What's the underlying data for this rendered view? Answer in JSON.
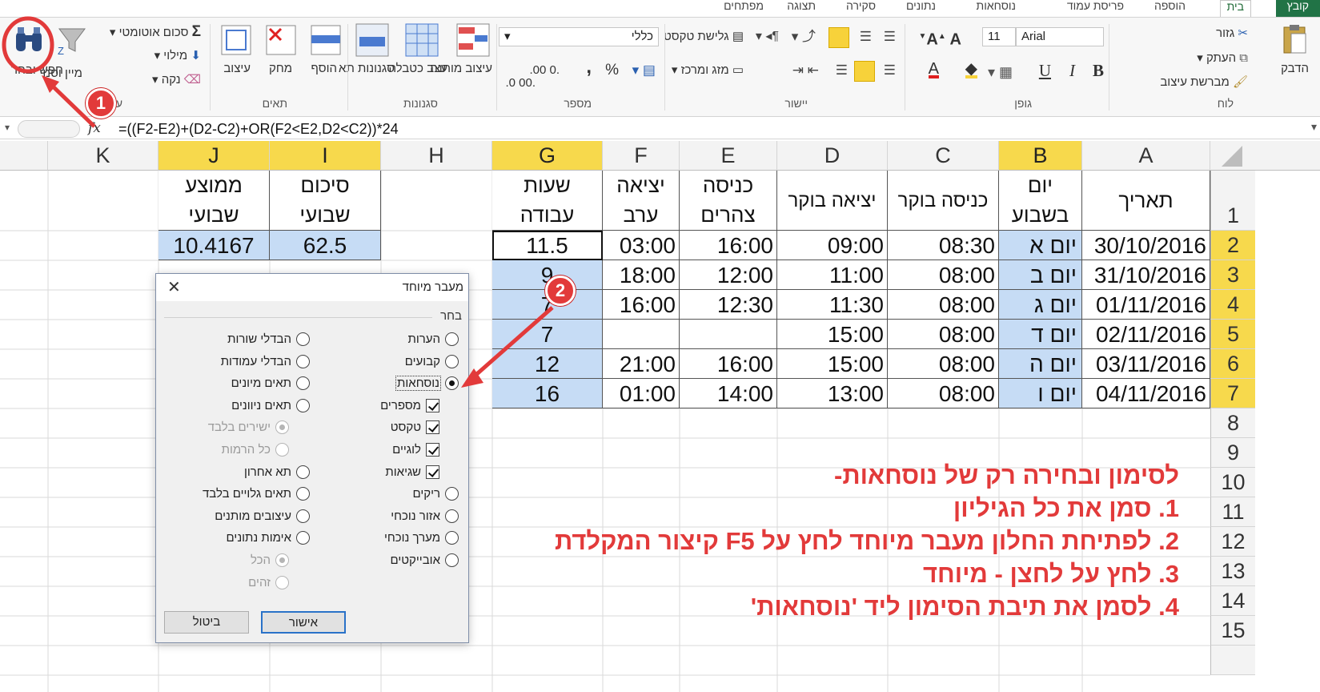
{
  "tabs": [
    "קובץ",
    "בית",
    "הוספה",
    "פריסת עמוד",
    "נוסחאות",
    "נתונים",
    "סקירה",
    "תצוגה",
    "מפתחים"
  ],
  "ribbon": {
    "clipboard": {
      "paste": "הדבק",
      "cut": "גזור",
      "copy": "העתק",
      "format_painter": "מברשת עיצוב",
      "group": "לוח"
    },
    "font": {
      "name": "Arial",
      "size": "11",
      "bold": "B",
      "italic": "I",
      "underline": "U",
      "group": "גופן"
    },
    "alignment": {
      "wrap": "גלישת טקסט",
      "merge": "מזג ומרכז",
      "group": "יישור"
    },
    "number": {
      "format": "כללי",
      "percent": "%",
      "comma": ",",
      "inc_dec": ".00 0.",
      "dec_dec": ".0 00.",
      "group": "מספר"
    },
    "styles": {
      "conditional": "עיצוב מותנה",
      "table": "עצב כטבלה",
      "cell": "סגנונות תא",
      "group": "סגנונות"
    },
    "cells": {
      "insert": "הוסף",
      "delete": "מחק",
      "format": "עיצוב",
      "group": "תאים"
    },
    "editing": {
      "autosum": "סכום אוטומטי",
      "fill": "מילוי",
      "clear": "נקה",
      "sort": "מיין וסנן",
      "find": "חפש ובחר",
      "group": "עריכה"
    }
  },
  "formula_bar": {
    "fx": "fx",
    "formula": "=((F2-E2)+(D2-C2)+OR(F2<E2,D2<C2))*24"
  },
  "columns": [
    "A",
    "B",
    "C",
    "D",
    "E",
    "F",
    "G",
    "H",
    "I",
    "J",
    "K"
  ],
  "rows": [
    "1",
    "2",
    "3",
    "4",
    "5",
    "6",
    "7",
    "8",
    "9",
    "10",
    "11",
    "12",
    "13",
    "14",
    "15"
  ],
  "headers": {
    "A": "תאריך",
    "B1": "יום",
    "B2": "בשבוע",
    "C": "כניסה בוקר",
    "D": "יציאה בוקר",
    "E1": "כניסה",
    "E2": "צהרים",
    "F1": "יציאה",
    "F2": "ערב",
    "G1": "שעות",
    "G2": "עבודה",
    "I1": "סיכום",
    "I2": "שבועי",
    "J1": "ממוצע",
    "J2": "שבועי"
  },
  "table": [
    {
      "date": "30/10/2016",
      "day": "יום א",
      "in_am": "08:30",
      "out_am": "09:00",
      "in_noon": "16:00",
      "out_eve": "03:00",
      "hours": "11.5"
    },
    {
      "date": "31/10/2016",
      "day": "יום ב",
      "in_am": "08:00",
      "out_am": "11:00",
      "in_noon": "12:00",
      "out_eve": "18:00",
      "hours": "9"
    },
    {
      "date": "01/11/2016",
      "day": "יום ג",
      "in_am": "08:00",
      "out_am": "11:30",
      "in_noon": "12:30",
      "out_eve": "16:00",
      "hours": "7"
    },
    {
      "date": "02/11/2016",
      "day": "יום ד",
      "in_am": "08:00",
      "out_am": "15:00",
      "in_noon": "",
      "out_eve": "",
      "hours": "7"
    },
    {
      "date": "03/11/2016",
      "day": "יום ה",
      "in_am": "08:00",
      "out_am": "15:00",
      "in_noon": "16:00",
      "out_eve": "21:00",
      "hours": "12"
    },
    {
      "date": "04/11/2016",
      "day": "יום ו",
      "in_am": "08:00",
      "out_am": "13:00",
      "in_noon": "14:00",
      "out_eve": "01:00",
      "hours": "16"
    }
  ],
  "summary": {
    "weekly_total": "62.5",
    "weekly_avg": "10.4167"
  },
  "instructions": [
    "לסימון ובחירה רק של נוסחאות-",
    "1. סמן את כל הגיליון",
    "2. לפתיחת החלון מעבר מיוחד לחץ על  F5  קיצור המקלדת",
    "3. לחץ על לחצן - מיוחד",
    "4. לסמן את תיבת הסימון ליד 'נוסחאות'"
  ],
  "dialog": {
    "title": "מעבר מיוחד",
    "group": "בחר",
    "right_options": [
      {
        "label": "הערות",
        "kind": "radio",
        "on": false,
        "dis": false
      },
      {
        "label": "קבועים",
        "kind": "radio",
        "on": false,
        "dis": false
      },
      {
        "label": "נוסחאות",
        "kind": "radio",
        "on": true,
        "dis": false
      },
      {
        "label": "מספרים",
        "kind": "check",
        "on": true,
        "dis": false
      },
      {
        "label": "טקסט",
        "kind": "check",
        "on": true,
        "dis": false
      },
      {
        "label": "לוגיים",
        "kind": "check",
        "on": true,
        "dis": false
      },
      {
        "label": "שגיאות",
        "kind": "check",
        "on": true,
        "dis": false
      },
      {
        "label": "ריקים",
        "kind": "radio",
        "on": false,
        "dis": false
      },
      {
        "label": "אזור נוכחי",
        "kind": "radio",
        "on": false,
        "dis": false
      },
      {
        "label": "מערך נוכחי",
        "kind": "radio",
        "on": false,
        "dis": false
      },
      {
        "label": "אובייקטים",
        "kind": "radio",
        "on": false,
        "dis": false
      }
    ],
    "left_options": [
      {
        "label": "הבדלי שורות",
        "kind": "radio",
        "on": false,
        "dis": false
      },
      {
        "label": "הבדלי עמודות",
        "kind": "radio",
        "on": false,
        "dis": false
      },
      {
        "label": "תאים מיונים",
        "kind": "radio",
        "on": false,
        "dis": false
      },
      {
        "label": "תאים ניוונים",
        "kind": "radio",
        "on": false,
        "dis": false
      },
      {
        "label": "ישירים בלבד",
        "kind": "radio",
        "on": true,
        "dis": true
      },
      {
        "label": "כל הרמות",
        "kind": "radio",
        "on": false,
        "dis": true
      },
      {
        "label": "תא אחרון",
        "kind": "radio",
        "on": false,
        "dis": false
      },
      {
        "label": "תאים גלויים בלבד",
        "kind": "radio",
        "on": false,
        "dis": false
      },
      {
        "label": "עיצובים מותנים",
        "kind": "radio",
        "on": false,
        "dis": false
      },
      {
        "label": "אימות נתונים",
        "kind": "radio",
        "on": false,
        "dis": false
      },
      {
        "label": "הכל",
        "kind": "radio",
        "on": true,
        "dis": true
      },
      {
        "label": "זהים",
        "kind": "radio",
        "on": false,
        "dis": true
      }
    ],
    "ok": "אישור",
    "cancel": "ביטול"
  },
  "badges": [
    "1",
    "2"
  ],
  "colors": {
    "accent": "#217346",
    "selected_header": "#f7d94c",
    "cell_blue": "#c6dcf5",
    "annotation": "#e23a3a"
  }
}
